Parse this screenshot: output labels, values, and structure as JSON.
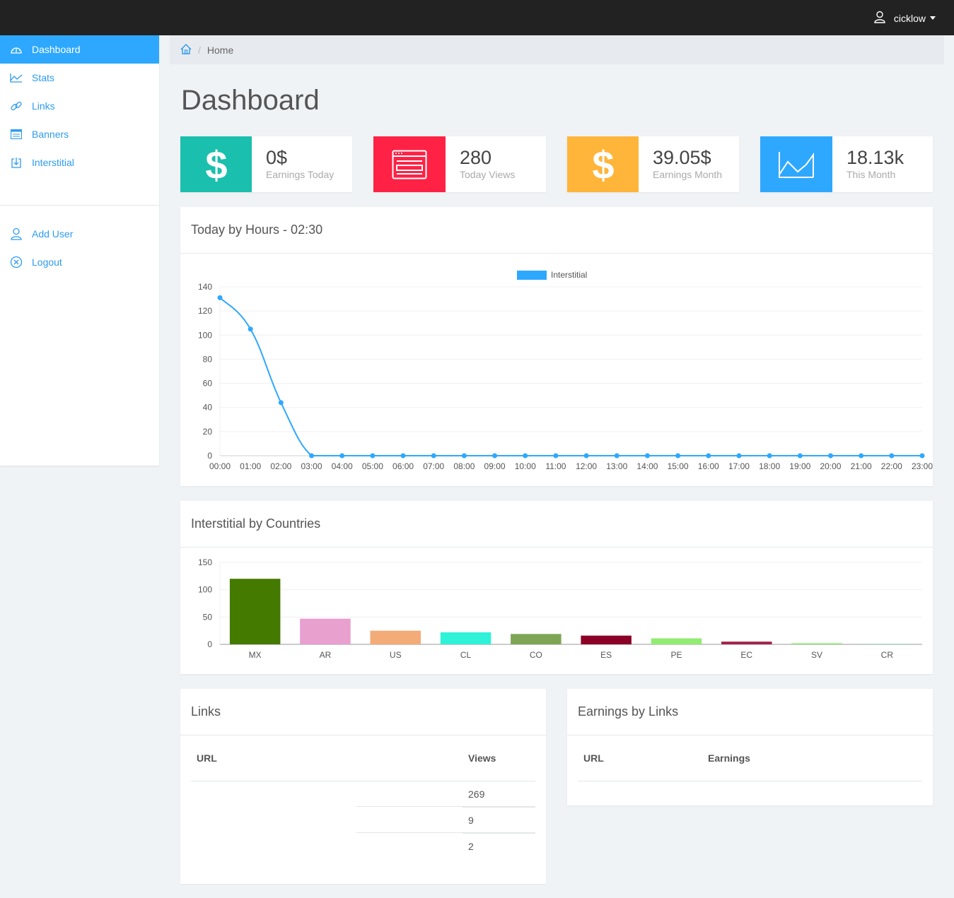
{
  "topbar": {
    "username": "cicklow",
    "user_icon": "user-icon"
  },
  "sidebar": {
    "items": [
      {
        "label": "Dashboard",
        "icon": "dashboard-icon",
        "active": true
      },
      {
        "label": "Stats",
        "icon": "line-chart-icon"
      },
      {
        "label": "Links",
        "icon": "link-icon"
      },
      {
        "label": "Banners",
        "icon": "banner-icon"
      },
      {
        "label": "Interstitial",
        "icon": "download-icon"
      }
    ],
    "secondary": [
      {
        "label": "Add User",
        "icon": "user-icon"
      },
      {
        "label": "Logout",
        "icon": "close-circle-icon"
      }
    ]
  },
  "breadcrumb": {
    "home_icon": "home-icon",
    "current": "Home"
  },
  "page_title": "Dashboard",
  "stats": [
    {
      "value": "0$",
      "label": "Earnings Today",
      "icon": "dollar-icon",
      "color": "#1bbfad"
    },
    {
      "value": "280",
      "label": "Today Views",
      "icon": "browser-window-icon",
      "color": "#ff2245"
    },
    {
      "value": "39.05$",
      "label": "Earnings Month",
      "icon": "dollar-icon",
      "color": "#ffb53a"
    },
    {
      "value": "18.13k",
      "label": "This Month",
      "icon": "area-chart-icon",
      "color": "#2ea8ff"
    }
  ],
  "hours_panel": {
    "title": "Today by Hours - 02:30"
  },
  "countries_panel": {
    "title": "Interstitial by Countries"
  },
  "links_panel": {
    "title": "Links",
    "col_url": "URL",
    "col_views": "Views",
    "rows": [
      {
        "url": "",
        "views": "269"
      },
      {
        "url": "",
        "views": "9"
      },
      {
        "url": "",
        "views": "2"
      }
    ]
  },
  "earnings_panel": {
    "title": "Earnings by Links",
    "col_url": "URL",
    "col_earnings": "Earnings"
  },
  "colors": {
    "accent": "#2ea8ff",
    "topbar": "#222222",
    "background": "#f0f3f5"
  },
  "chart_data": [
    {
      "type": "line",
      "title": "",
      "series": [
        {
          "name": "Interstitial",
          "color": "#2ea8ff",
          "values": [
            131,
            105,
            44,
            0,
            0,
            0,
            0,
            0,
            0,
            0,
            0,
            0,
            0,
            0,
            0,
            0,
            0,
            0,
            0,
            0,
            0,
            0,
            0,
            0
          ]
        }
      ],
      "categories": [
        "00:00",
        "01:00",
        "02:00",
        "03:00",
        "04:00",
        "05:00",
        "06:00",
        "07:00",
        "08:00",
        "09:00",
        "10:00",
        "11:00",
        "12:00",
        "13:00",
        "14:00",
        "15:00",
        "16:00",
        "17:00",
        "18:00",
        "19:00",
        "20:00",
        "21:00",
        "22:00",
        "23:00"
      ],
      "ylim": [
        0,
        140
      ],
      "yticks": [
        0,
        20,
        40,
        60,
        80,
        100,
        120,
        140
      ],
      "legend": "top-center",
      "grid": true
    },
    {
      "type": "bar",
      "title": "",
      "categories": [
        "MX",
        "AR",
        "US",
        "CL",
        "CO",
        "ES",
        "PE",
        "EC",
        "SV",
        "CR"
      ],
      "values": [
        120,
        47,
        25,
        22,
        19,
        16,
        11,
        5,
        2,
        1
      ],
      "colors": [
        "#447a00",
        "#e8a0cf",
        "#f3ab77",
        "#2ff2d8",
        "#7ea456",
        "#8b0026",
        "#92ec72",
        "#a1244a",
        "#8bea6a",
        "#9cd2c6"
      ],
      "ylim": [
        0,
        150
      ],
      "yticks": [
        0,
        50,
        100,
        150
      ],
      "grid": true
    }
  ]
}
